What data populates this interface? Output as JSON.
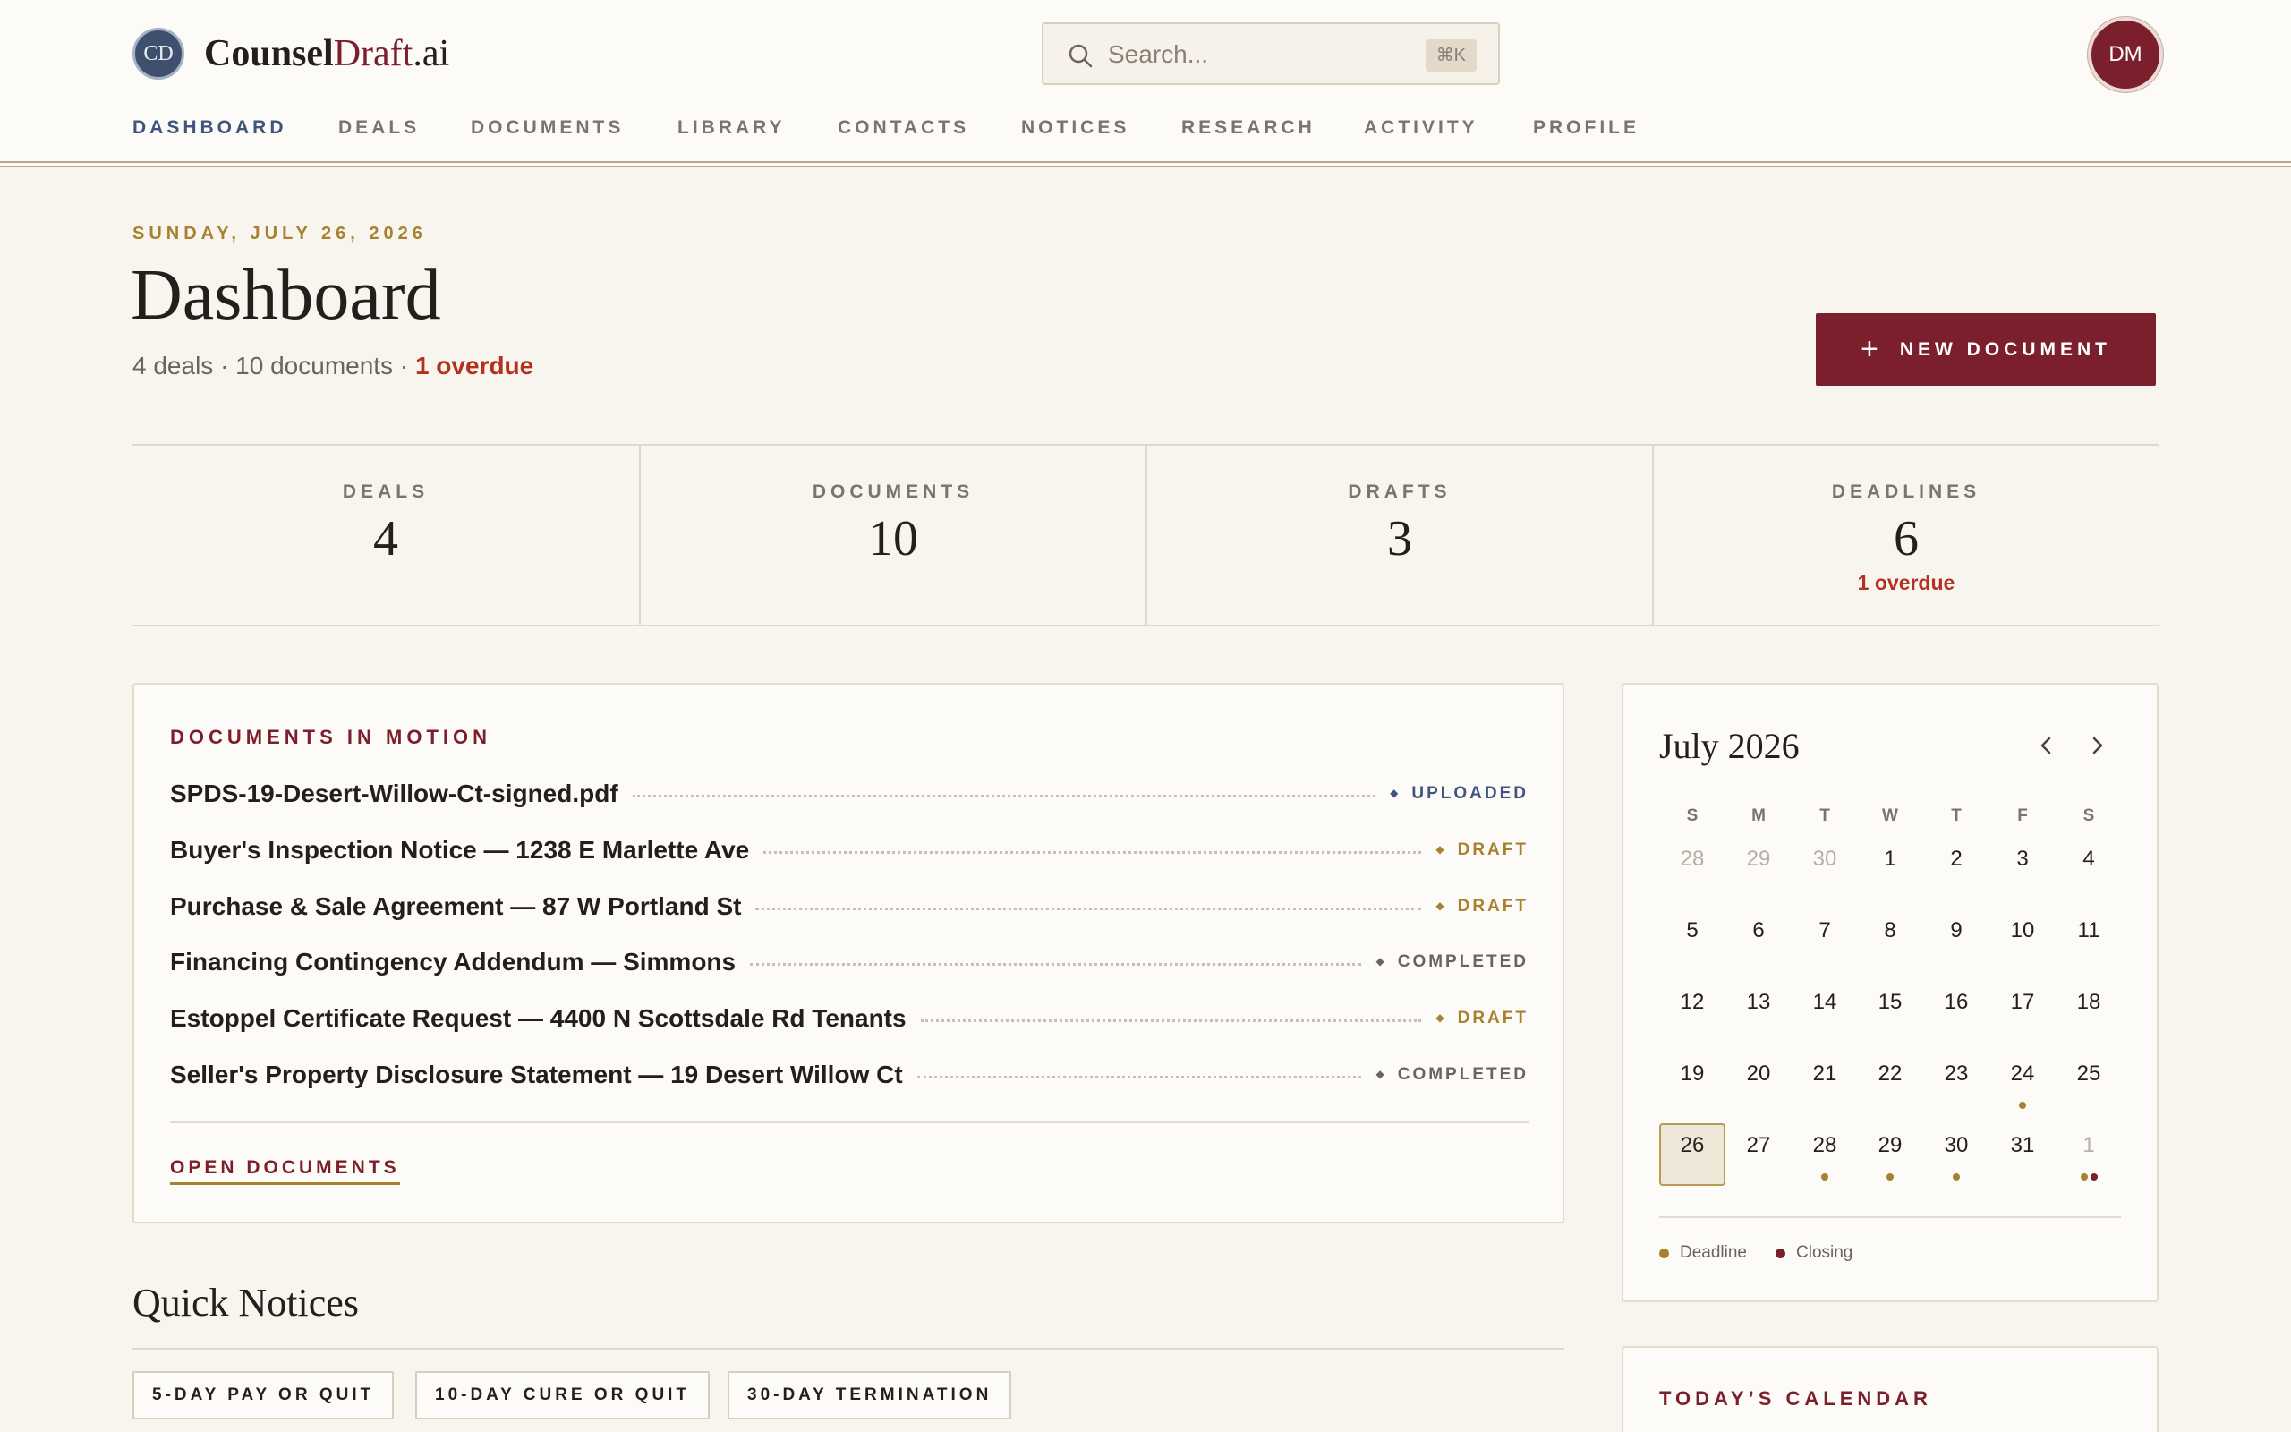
{
  "app": {
    "logo_initials": "CD",
    "logo_name_part1": "Counsel",
    "logo_name_part2": "Draft",
    "logo_name_part3": ".ai",
    "search_placeholder": "Search...",
    "search_shortcut": "⌘K",
    "avatar_initials": "DM",
    "brand_color": "#7a1f2b",
    "accent_gold": "#a7812f",
    "accent_navy": "#3f557d"
  },
  "nav": [
    {
      "label": "DASHBOARD",
      "active": true
    },
    {
      "label": "DEALS"
    },
    {
      "label": "DOCUMENTS"
    },
    {
      "label": "LIBRARY"
    },
    {
      "label": "CONTACTS"
    },
    {
      "label": "NOTICES"
    },
    {
      "label": "RESEARCH"
    },
    {
      "label": "ACTIVITY"
    },
    {
      "label": "PROFILE"
    }
  ],
  "header": {
    "date": "SUNDAY, JULY 26, 2026",
    "title": "Dashboard",
    "summary_prefix": "4 deals · 10 documents · ",
    "summary_overdue": "1 overdue",
    "new_doc_icon": "+",
    "new_doc_label": "NEW DOCUMENT"
  },
  "stats": [
    {
      "label": "DEALS",
      "value": "4",
      "sub": ""
    },
    {
      "label": "DOCUMENTS",
      "value": "10",
      "sub": ""
    },
    {
      "label": "DRAFTS",
      "value": "3",
      "sub": ""
    },
    {
      "label": "DEADLINES",
      "value": "6",
      "sub": "1 overdue"
    }
  ],
  "documents": {
    "heading": "DOCUMENTS IN MOTION",
    "items": [
      {
        "title": "SPDS-19-Desert-Willow-Ct-signed.pdf",
        "status": "UPLOADED",
        "kind": "uploaded"
      },
      {
        "title": "Buyer's Inspection Notice — 1238 E Marlette Ave",
        "status": "DRAFT",
        "kind": "draft"
      },
      {
        "title": "Purchase & Sale Agreement — 87 W Portland St",
        "status": "DRAFT",
        "kind": "draft"
      },
      {
        "title": "Financing Contingency Addendum — Simmons",
        "status": "COMPLETED",
        "kind": "completed"
      },
      {
        "title": "Estoppel Certificate Request — 4400 N Scottsdale Rd Tenants",
        "status": "DRAFT",
        "kind": "draft"
      },
      {
        "title": "Seller's Property Disclosure Statement — 19 Desert Willow Ct",
        "status": "COMPLETED",
        "kind": "completed"
      }
    ],
    "link": "OPEN DOCUMENTS"
  },
  "quick_notices": {
    "title": "Quick Notices",
    "buttons": [
      "5-DAY PAY OR QUIT",
      "10-DAY CURE OR QUIT",
      "30-DAY TERMINATION"
    ]
  },
  "calendar": {
    "month": "July 2026",
    "weekdays": [
      "S",
      "M",
      "T",
      "W",
      "T",
      "F",
      "S"
    ],
    "weeks": [
      [
        {
          "d": "28",
          "muted": true
        },
        {
          "d": "29",
          "muted": true
        },
        {
          "d": "30",
          "muted": true
        },
        {
          "d": "1"
        },
        {
          "d": "2"
        },
        {
          "d": "3"
        },
        {
          "d": "4"
        }
      ],
      [
        {
          "d": "5"
        },
        {
          "d": "6"
        },
        {
          "d": "7"
        },
        {
          "d": "8"
        },
        {
          "d": "9"
        },
        {
          "d": "10"
        },
        {
          "d": "11"
        }
      ],
      [
        {
          "d": "12"
        },
        {
          "d": "13"
        },
        {
          "d": "14"
        },
        {
          "d": "15"
        },
        {
          "d": "16"
        },
        {
          "d": "17"
        },
        {
          "d": "18"
        }
      ],
      [
        {
          "d": "19"
        },
        {
          "d": "20"
        },
        {
          "d": "21"
        },
        {
          "d": "22"
        },
        {
          "d": "23"
        },
        {
          "d": "24",
          "dots": [
            "deadline"
          ]
        },
        {
          "d": "25"
        }
      ],
      [
        {
          "d": "26",
          "today": true
        },
        {
          "d": "27"
        },
        {
          "d": "28",
          "dots": [
            "deadline"
          ]
        },
        {
          "d": "29",
          "dots": [
            "deadline"
          ]
        },
        {
          "d": "30",
          "dots": [
            "deadline"
          ]
        },
        {
          "d": "31"
        },
        {
          "d": "1",
          "muted": true,
          "dots": [
            "deadline",
            "closing"
          ]
        }
      ]
    ],
    "legend": [
      {
        "label": "Deadline",
        "kind": "deadline"
      },
      {
        "label": "Closing",
        "kind": "closing"
      }
    ]
  },
  "today_calendar": {
    "heading": "TODAY’S CALENDAR"
  }
}
